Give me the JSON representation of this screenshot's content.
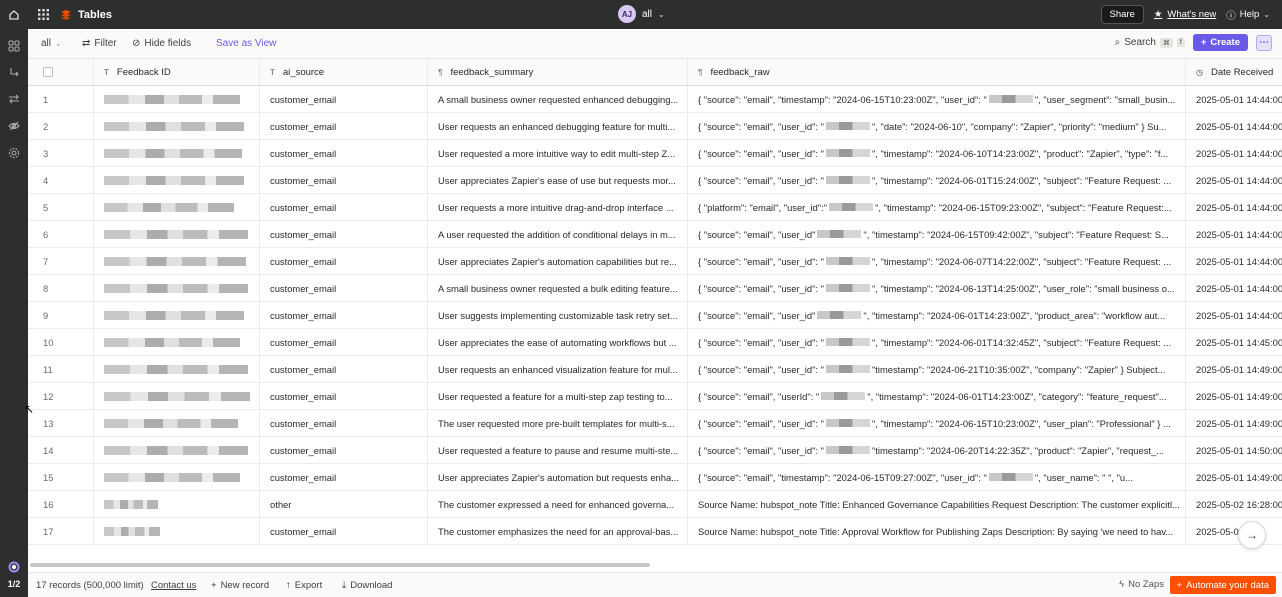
{
  "app": {
    "title": "Tables",
    "brand_color": "#ff4f00",
    "accent": "#695be8"
  },
  "topbar": {
    "user_initials": "AJ",
    "view_label": "all",
    "share_label": "Share",
    "whats_new_label": "What's new",
    "help_label": "Help"
  },
  "rail": {
    "page_indicator": "1/2"
  },
  "toolbar": {
    "view_select": "all",
    "filter_label": "Filter",
    "hide_fields_label": "Hide fields",
    "save_view_label": "Save as View",
    "search_label": "Search",
    "kbd1": "⌘",
    "kbd2": "f",
    "create_label": "Create"
  },
  "table": {
    "columns": [
      {
        "label": "Feedback ID",
        "type_icon": "T"
      },
      {
        "label": "ai_source",
        "type_icon": "T"
      },
      {
        "label": "feedback_summary",
        "type_icon": "¶"
      },
      {
        "label": "feedback_raw",
        "type_icon": "¶"
      },
      {
        "label": "Date Received",
        "type_icon": "◷"
      }
    ],
    "rows": [
      {
        "n": "1",
        "source": "customer_email",
        "summary": "A small business owner requested enhanced debugging...",
        "raw_a": "{ \"source\": \"email\", \"timestamp\": \"2024-06-15T10:23:00Z\", \"user_id\": \"",
        "raw_b": "\", \"user_segment\": \"small_busin...",
        "date": "2025-05-01 14:44:00"
      },
      {
        "n": "2",
        "source": "customer_email",
        "summary": "User requests an enhanced debugging feature for multi...",
        "raw_a": "{ \"source\": \"email\", \"user_id\": \"",
        "raw_b": "\", \"date\": \"2024-06-10\", \"company\": \"Zapier\", \"priority\": \"medium\" } Su...",
        "date": "2025-05-01 14:44:00"
      },
      {
        "n": "3",
        "source": "customer_email",
        "summary": "User requested a more intuitive way to edit multi-step Z...",
        "raw_a": "{ \"source\": \"email\", \"user_id\": \"",
        "raw_b": "\", \"timestamp\": \"2024-06-10T14:23:00Z\", \"product\": \"Zapier\", \"type\": \"f...",
        "date": "2025-05-01 14:44:00"
      },
      {
        "n": "4",
        "source": "customer_email",
        "summary": "User appreciates Zapier's ease of use but requests mor...",
        "raw_a": "{ \"source\": \"email\", \"user_id\": \"",
        "raw_b": "\", \"timestamp\": \"2024-06-01T15:24:00Z\", \"subject\": \"Feature Request: ...",
        "date": "2025-05-01 14:44:00"
      },
      {
        "n": "5",
        "source": "customer_email",
        "summary": "User requests a more intuitive drag-and-drop interface ...",
        "raw_a": "{ \"platform\": \"email\", \"user_id\":\"",
        "raw_b": "\", \"timestamp\": \"2024-06-15T09:23:00Z\", \"subject\": \"Feature Request:...",
        "date": "2025-05-01 14:44:00"
      },
      {
        "n": "6",
        "source": "customer_email",
        "summary": "A user requested the addition of conditional delays in m...",
        "raw_a": "{ \"source\": \"email\", \"user_id\"",
        "raw_b": "\", \"timestamp\": \"2024-06-15T09:42:00Z\", \"subject\": \"Feature Request: S...",
        "date": "2025-05-01 14:44:00"
      },
      {
        "n": "7",
        "source": "customer_email",
        "summary": "User appreciates Zapier's automation capabilities but re...",
        "raw_a": "{ \"source\": \"email\", \"user_id\": \"",
        "raw_b": "\", \"timestamp\": \"2024-06-07T14:22:00Z\", \"subject\": \"Feature Request: ...",
        "date": "2025-05-01 14:44:00"
      },
      {
        "n": "8",
        "source": "customer_email",
        "summary": "A small business owner requested a bulk editing feature...",
        "raw_a": "{ \"source\": \"email\", \"user_id\": \"",
        "raw_b": "\", \"timestamp\": \"2024-06-13T14:25:00Z\", \"user_role\": \"small business o...",
        "date": "2025-05-01 14:44:00"
      },
      {
        "n": "9",
        "source": "customer_email",
        "summary": "User suggests implementing customizable task retry set...",
        "raw_a": "{ \"source\": \"email\", \"user_id\"",
        "raw_b": "\", \"timestamp\": \"2024-06-01T14:23:00Z\", \"product_area\": \"workflow aut...",
        "date": "2025-05-01 14:44:00"
      },
      {
        "n": "10",
        "source": "customer_email",
        "summary": "User appreciates the ease of automating workflows but ...",
        "raw_a": "{ \"source\": \"email\", \"user_id\": \"",
        "raw_b": "\", \"timestamp\": \"2024-06-01T14:32:45Z\", \"subject\": \"Feature Request: ...",
        "date": "2025-05-01 14:45:00"
      },
      {
        "n": "11",
        "source": "customer_email",
        "summary": "User requests an enhanced visualization feature for mul...",
        "raw_a": "{ \"source\": \"email\", \"user_id\": \"",
        "raw_b": "\"timestamp\": \"2024-06-21T10:35:00Z\", \"company\": \"Zapier\" } Subject...",
        "date": "2025-05-01 14:49:00"
      },
      {
        "n": "12",
        "source": "customer_email",
        "summary": "User requested a feature for a multi-step zap testing to...",
        "raw_a": "{ \"source\": \"email\", \"userId\": \"",
        "raw_b": "\", \"timestamp\": \"2024-06-01T14:23:00Z\", \"category\": \"feature_request\"...",
        "date": "2025-05-01 14:49:00"
      },
      {
        "n": "13",
        "source": "customer_email",
        "summary": "The user requested more pre-built templates for multi-s...",
        "raw_a": "{ \"source\": \"email\", \"user_id\": \"",
        "raw_b": "\", \"timestamp\": \"2024-06-15T10:23:00Z\", \"user_plan\": \"Professional\" } ...",
        "date": "2025-05-01 14:49:00"
      },
      {
        "n": "14",
        "source": "customer_email",
        "summary": "User requested a feature to pause and resume multi-ste...",
        "raw_a": "{ \"source\": \"email\", \"user_id\": \"",
        "raw_b": "\"timestamp\": \"2024-06-20T14:22:35Z\", \"product\": \"Zapier\", \"request_...",
        "date": "2025-05-01 14:50:00"
      },
      {
        "n": "15",
        "source": "customer_email",
        "summary": "User appreciates Zapier's automation but requests enha...",
        "raw_a": "{ \"source\": \"email\", \"timestamp\": \"2024-06-15T09:27:00Z\", \"user_id\": \"",
        "raw_b": "\", \"user_name\": \"          \", \"u...",
        "date": "2025-05-01 14:49:00"
      },
      {
        "n": "16",
        "source": "other",
        "summary": "The customer expressed a need for enhanced governa...",
        "raw_a": "Source Name: hubspot_note Title: Enhanced Governance Capabilities Request Description: The customer explicitl...",
        "raw_b": "",
        "date": "2025-05-02 16:28:00"
      },
      {
        "n": "17",
        "source": "customer_email",
        "summary": "The customer emphasizes the need for an approval-bas...",
        "raw_a": "Source Name: hubspot_note Title: Approval Workflow for Publishing Zaps Description: By saying 'we need to hav...",
        "raw_b": "",
        "date": "2025-05-0"
      }
    ]
  },
  "footer": {
    "records": "17 records (500,000 limit)",
    "contact": "Contact us",
    "new_record": "New record",
    "export": "Export",
    "download": "Download",
    "no_zaps": "No Zaps",
    "automate": "Automate your data"
  }
}
